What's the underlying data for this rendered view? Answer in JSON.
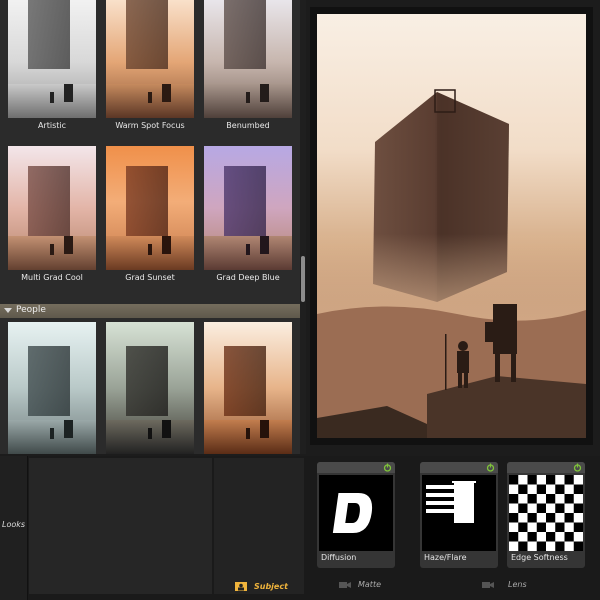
{
  "browser": {
    "row1": [
      "Artistic",
      "Warm Spot Focus",
      "Benumbed"
    ],
    "row2": [
      "Multi Grad Cool",
      "Grad Sunset",
      "Grad Deep Blue"
    ],
    "section": "People"
  },
  "bottom": {
    "looks_label": "Looks",
    "tabs": {
      "subject": "Subject",
      "matte": "Matte",
      "lens": "Lens"
    },
    "tools": {
      "diffusion": "Diffusion",
      "haze_flare": "Haze/Flare",
      "edge_softness": "Edge Softness"
    }
  },
  "colors": {
    "accent": "#f0b43c",
    "power": "#7fc33a",
    "section_bar": "#6b6455"
  },
  "icons": [
    "power-icon",
    "subject-icon",
    "camera-icon",
    "triangle-down-icon"
  ]
}
